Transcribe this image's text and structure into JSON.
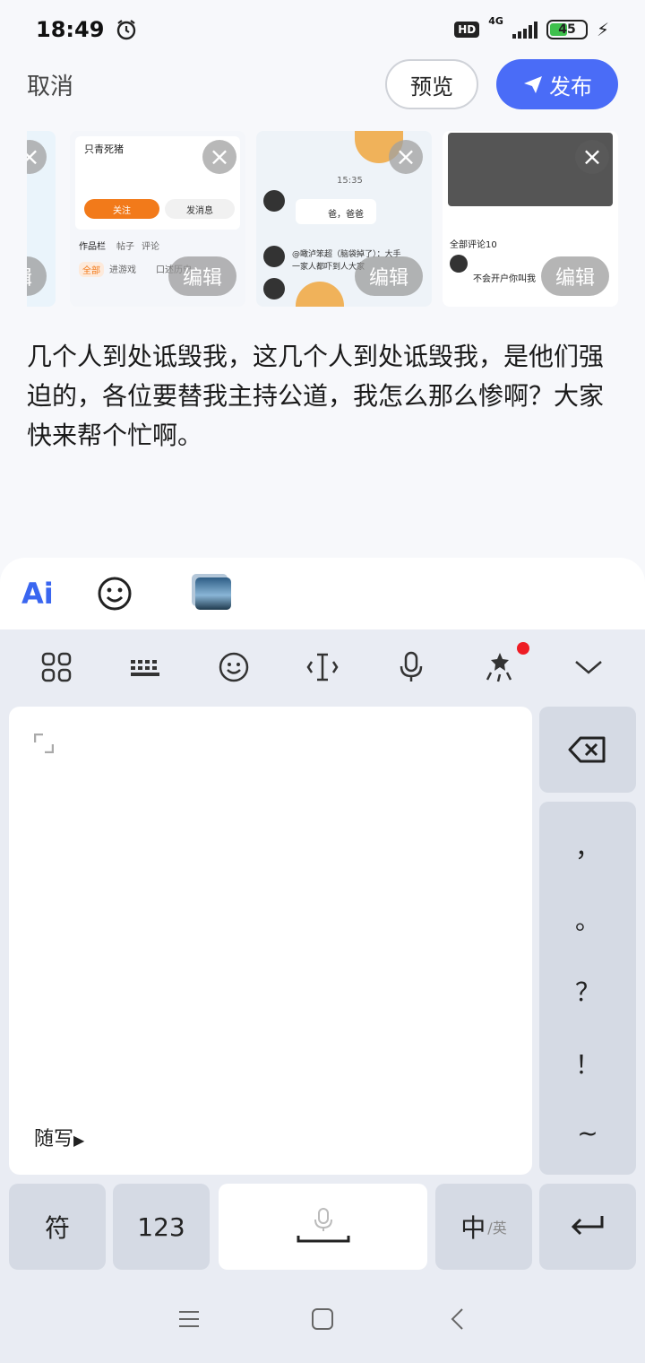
{
  "status_bar": {
    "time": "18:49",
    "hd": "HD",
    "network": "4G",
    "battery": "45",
    "icons": [
      "alarm-icon",
      "signal-icon",
      "battery-icon",
      "charging-bolt-icon"
    ]
  },
  "header": {
    "cancel_label": "取消",
    "preview_label": "预览",
    "publish_label": "发布",
    "publish_icon": "send-arrow-icon"
  },
  "thumbnails": [
    {
      "edit_label": "编辑",
      "close_icon": "close-icon"
    },
    {
      "edit_label": "编辑",
      "close_icon": "close-icon",
      "text": [
        "只青死猪",
        "作品栏",
        "帖子",
        "评论",
        "关注",
        "发消息",
        "全部",
        "进游戏",
        "口述历史"
      ]
    },
    {
      "edit_label": "编辑",
      "close_icon": "close-icon",
      "text": [
        "15:35",
        "爸，爸爸",
        "@瞰泸笨超（脑袋掉了）：大手",
        "一家人都吓到人大家"
      ]
    },
    {
      "edit_label": "编辑",
      "close_icon": "close-icon",
      "text": [
        "全部评论10",
        "不会开户你叫我"
      ]
    }
  ],
  "post": {
    "text": "几个人到处诋毁我，这几个人到处诋毁我，是他们强迫的，各位要替我主持公道，我怎么那么惨啊？大家快来帮个忙啊。"
  },
  "input_toolbar": {
    "ai_label": "Ai",
    "icons": [
      "ai-icon",
      "emoji-icon",
      "image-icon"
    ]
  },
  "keyboard": {
    "top_icons": [
      "apps-grid-icon",
      "keyboard-icon",
      "emoji-icon",
      "cursor-icon",
      "microphone-icon",
      "magic-stars-icon",
      "collapse-chevron-icon"
    ],
    "handwriting_label": "随写",
    "punctuation": [
      "，",
      "。",
      "？",
      "！",
      "~"
    ],
    "symbol_key": "符",
    "number_key": "123",
    "lang_key_main": "中",
    "lang_key_sub": "/英",
    "accent_color": "#4a6cf7"
  },
  "navbar": {
    "icons": [
      "menu-icon",
      "home-icon",
      "back-icon"
    ]
  }
}
